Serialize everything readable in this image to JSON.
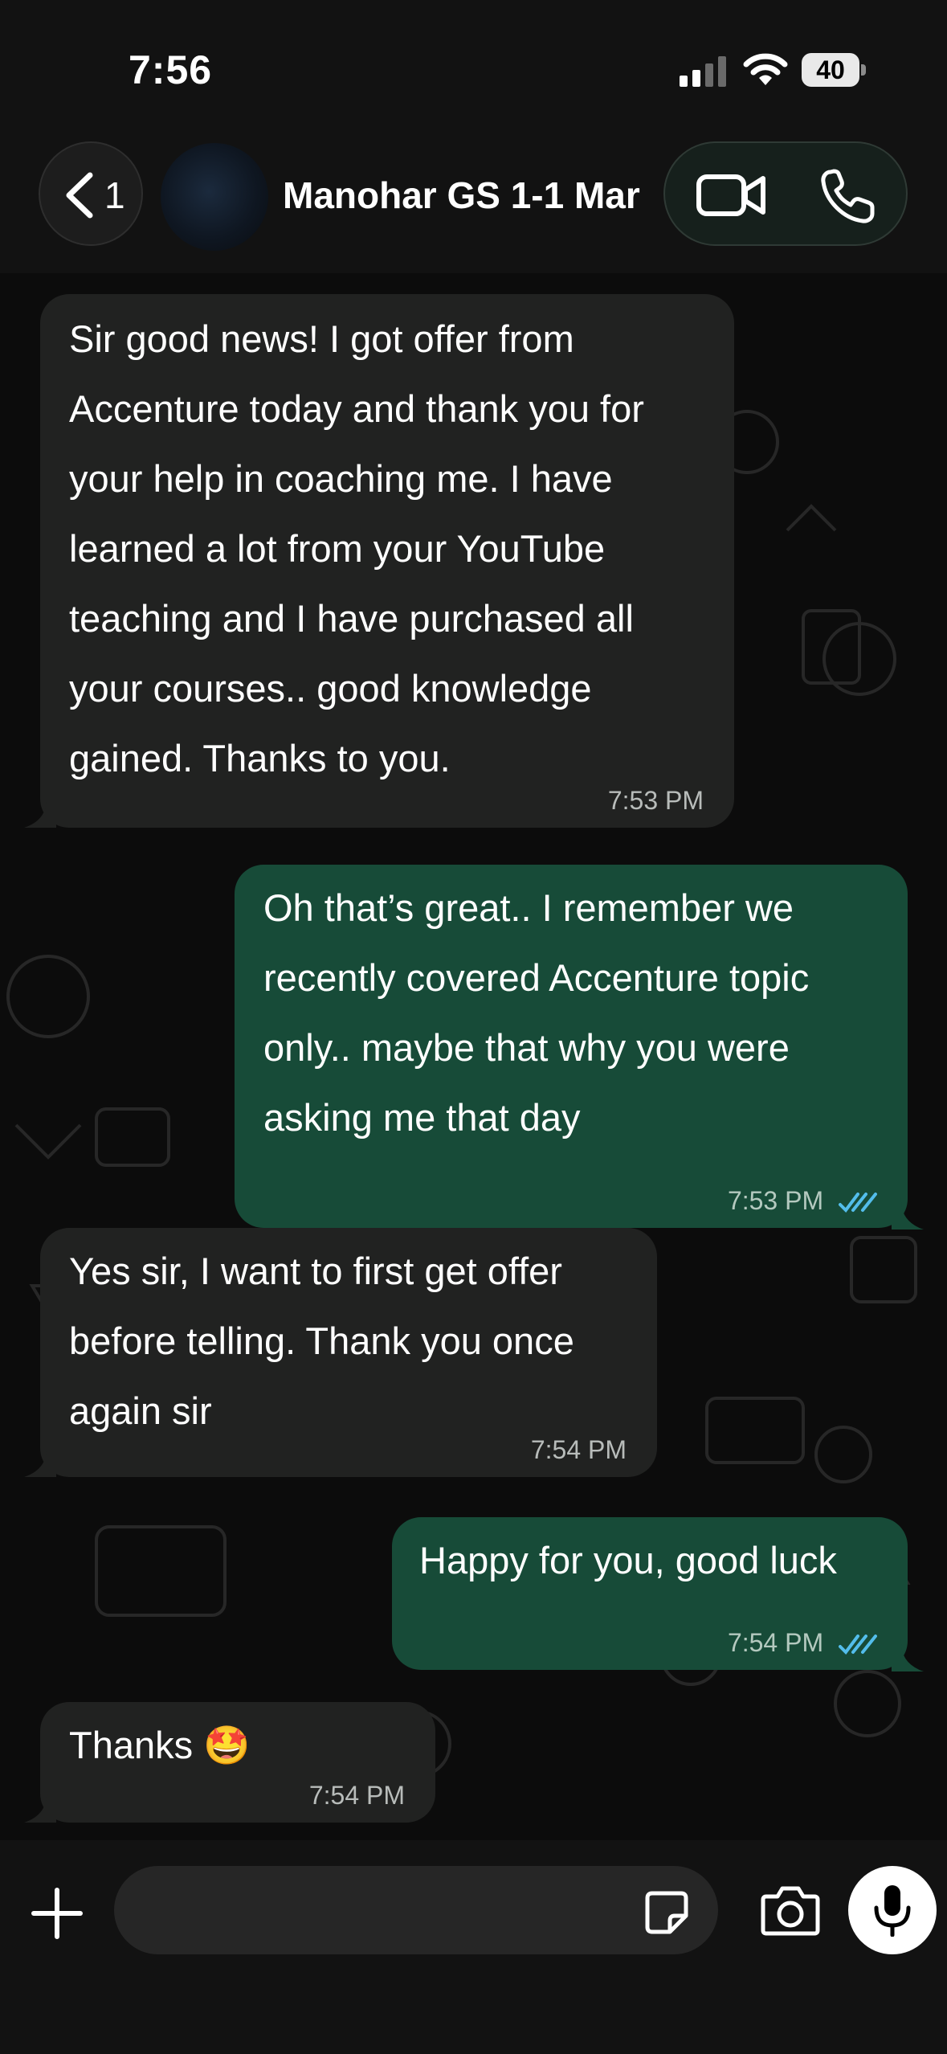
{
  "status_bar": {
    "time": "7:56",
    "battery": "40"
  },
  "header": {
    "back_count": "1",
    "contact_name": "Manohar GS 1-1 Mar"
  },
  "messages": [
    {
      "direction": "in",
      "text": "Sir good news! I got offer from\nAccenture today and thank you for\nyour help in coaching me. I have\nlearned a lot from your YouTube\nteaching and I have purchased all\nyour courses.. good knowledge\ngained. Thanks to you.",
      "time": "7:53 PM"
    },
    {
      "direction": "out",
      "text": "Oh that’s great.. I remember we\nrecently covered Accenture topic\nonly.. maybe that why you were\nasking me that day",
      "time": "7:53 PM",
      "status": "read"
    },
    {
      "direction": "in",
      "text": "Yes sir, I want to first get offer\nbefore telling. Thank you once\nagain sir",
      "time": "7:54 PM"
    },
    {
      "direction": "out",
      "text": "Happy for you, good luck",
      "time": "7:54 PM",
      "status": "read"
    },
    {
      "direction": "in",
      "text": "Thanks 🤩",
      "time": "7:54 PM"
    }
  ],
  "composer": {
    "placeholder": ""
  },
  "colors": {
    "incoming_bubble": "#212221",
    "outgoing_bubble": "#174b38",
    "read_ticks": "#53bdeb",
    "background": "#0c0c0c"
  },
  "icons": [
    "back-chevron-icon",
    "video-call-icon",
    "voice-call-icon",
    "plus-icon",
    "sticker-icon",
    "camera-icon",
    "microphone-icon"
  ]
}
